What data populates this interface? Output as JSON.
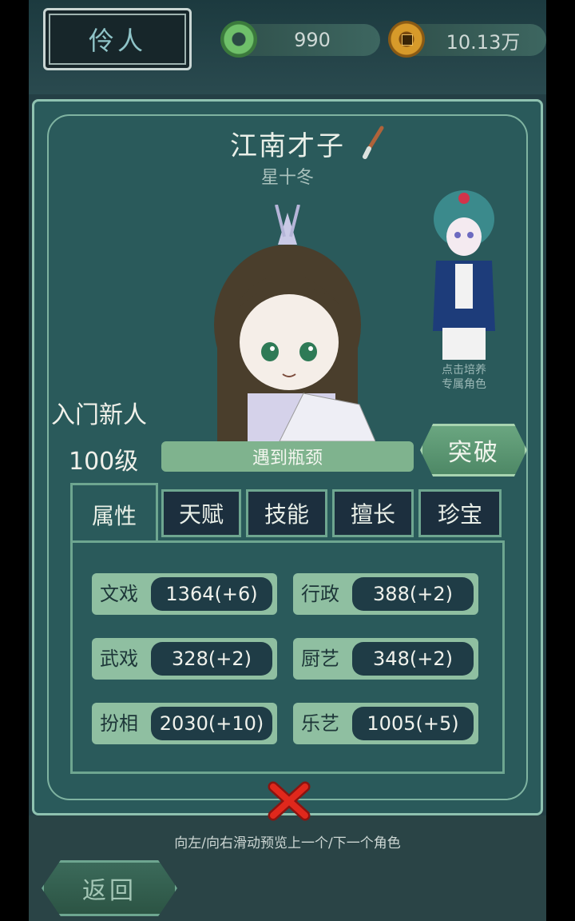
{
  "header": {
    "title": "伶人",
    "jade_count": "990",
    "coin_count": "10.13万"
  },
  "character": {
    "name": "江南才子",
    "subtitle": "星十冬",
    "rank": "入门新人",
    "level": "100级",
    "progress_text": "遇到瓶颈",
    "breakthrough_label": "突破",
    "mini_caption": "点击培养\n专属角色"
  },
  "tabs": [
    {
      "label": "属性",
      "active": true
    },
    {
      "label": "天赋",
      "active": false
    },
    {
      "label": "技能",
      "active": false
    },
    {
      "label": "擅长",
      "active": false
    },
    {
      "label": "珍宝",
      "active": false
    }
  ],
  "stats": [
    {
      "key": "文戏",
      "value": "1364(+6)"
    },
    {
      "key": "行政",
      "value": "388(+2)"
    },
    {
      "key": "武戏",
      "value": "328(+2)"
    },
    {
      "key": "厨艺",
      "value": "348(+2)"
    },
    {
      "key": "扮相",
      "value": "2030(+10)"
    },
    {
      "key": "乐艺",
      "value": "1005(+5)"
    }
  ],
  "footer": {
    "hint": "向左/向右滑动预览上一个/下一个角色",
    "back_label": "返回"
  },
  "colors": {
    "panel": "#2a5a5b",
    "accent_green": "#8fbfa1",
    "close_red": "#e0281c"
  }
}
